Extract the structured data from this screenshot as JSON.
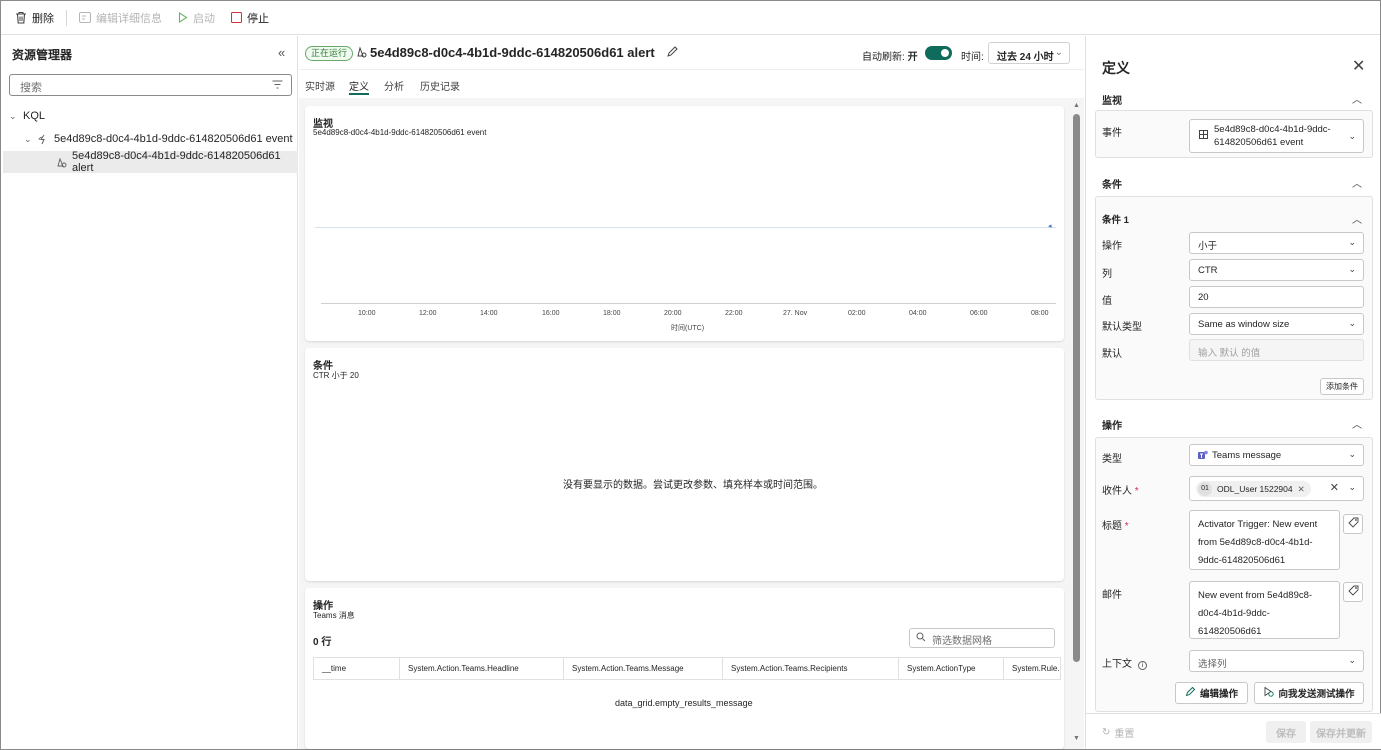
{
  "toolbar": {
    "delete": "删除",
    "edit_details": "编辑详细信息",
    "start": "启动",
    "stop": "停止"
  },
  "explorer": {
    "title": "资源管理器",
    "search_placeholder": "搜索",
    "tree": {
      "root": "KQL",
      "event": "5e4d89c8-d0c4-4b1d-9ddc-614820506d61 event",
      "alert": "5e4d89c8-d0c4-4b1d-9ddc-614820506d61 alert"
    }
  },
  "header": {
    "status": "正在运行",
    "title": "5e4d89c8-d0c4-4b1d-9ddc-614820506d61 alert",
    "auto_refresh_label": "自动刷新:",
    "auto_refresh_state": "开",
    "time_label": "时间:",
    "time_value": "过去 24 小时"
  },
  "tabs": [
    "实时源",
    "定义",
    "分析",
    "历史记录"
  ],
  "monitor_card": {
    "title": "监视",
    "subtitle": "5e4d89c8-d0c4-4b1d-9ddc-614820506d61 event",
    "x_ticks": [
      "10:00",
      "12:00",
      "14:00",
      "16:00",
      "18:00",
      "20:00",
      "22:00",
      "27. Nov",
      "02:00",
      "04:00",
      "06:00",
      "08:00"
    ],
    "x_label": "时间(UTC)"
  },
  "condition_card": {
    "title": "条件",
    "subtitle": "CTR 小于 20",
    "empty": "没有要显示的数据。尝试更改参数、填充样本或时间范围。"
  },
  "action_card": {
    "title": "操作",
    "subtitle": "Teams 消息",
    "rows": "0 行",
    "filter_placeholder": "筛选数据网格",
    "columns": [
      "__time",
      "System.Action.Teams.Headline",
      "System.Action.Teams.Message",
      "System.Action.Teams.Recipients",
      "System.ActionType",
      "System.Rule.I"
    ],
    "empty": "data_grid.empty_results_message"
  },
  "definition": {
    "title": "定义",
    "monitor": {
      "heading": "监视",
      "event_label": "事件",
      "event_value": "5e4d89c8-d0c4-4b1d-9ddc-614820506d61 event"
    },
    "condition": {
      "heading": "条件",
      "sub_heading": "条件 1",
      "op_label": "操作",
      "op_value": "小于",
      "col_label": "列",
      "col_value": "CTR",
      "val_label": "值",
      "val_value": "20",
      "default_type_label": "默认类型",
      "default_type_value": "Same as window size",
      "default_label": "默认",
      "default_placeholder": "输入 默认 的值",
      "add_button": "添加条件"
    },
    "action": {
      "heading": "操作",
      "type_label": "类型",
      "type_value": "Teams message",
      "recipient_label": "收件人",
      "recipient_initials": "01",
      "recipient_value": "ODL_User 1522904",
      "headline_label": "标题",
      "headline_value": "Activator Trigger: New event from 5e4d89c8-d0c4-4b1d-9ddc-614820506d61",
      "message_label": "邮件",
      "message_value": "New event from 5e4d89c8-d0c4-4b1d-9ddc-614820506d61",
      "context_label": "上下文",
      "context_placeholder": "选择列",
      "edit_action": "编辑操作",
      "send_test": "向我发送测试操作"
    },
    "footer": {
      "reset": "重置",
      "save": "保存",
      "save_update": "保存并更新"
    }
  },
  "colors": {
    "accent": "#0f6b5b",
    "running_badge": "#2e7d32",
    "stop_icon": "#d13438"
  }
}
